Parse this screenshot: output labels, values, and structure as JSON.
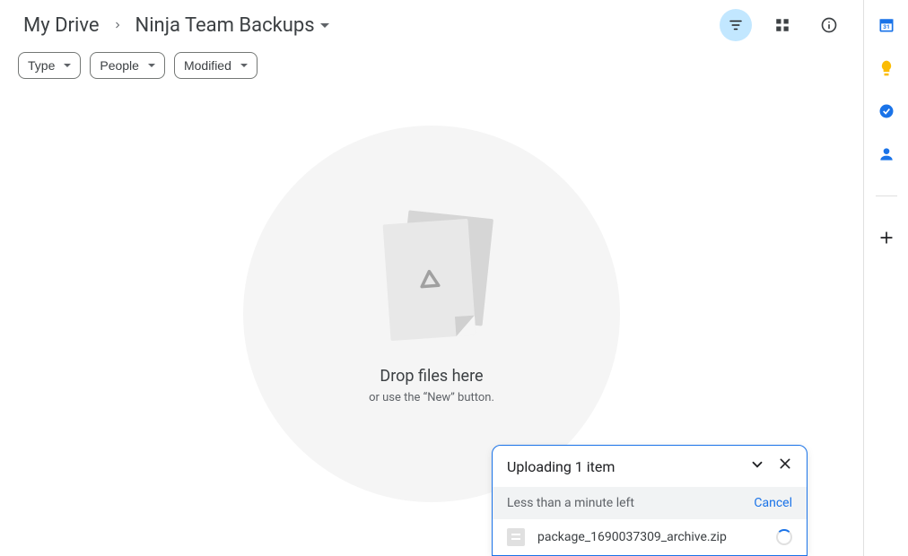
{
  "breadcrumb": {
    "root": "My Drive",
    "current": "Ninja Team Backups"
  },
  "filters": {
    "type": "Type",
    "people": "People",
    "modified": "Modified"
  },
  "empty": {
    "title": "Drop files here",
    "subtitle": "or use the “New” button."
  },
  "upload": {
    "title": "Uploading 1 item",
    "status": "Less than a minute left",
    "cancel": "Cancel",
    "file": "package_1690037309_archive.zip"
  },
  "sidepanel": {
    "calendar": "31"
  }
}
